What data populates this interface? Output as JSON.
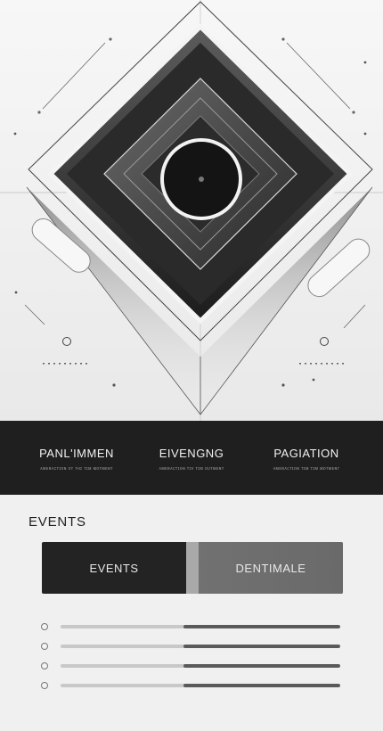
{
  "nav": {
    "items": [
      {
        "label": "PANL'IMMEN",
        "sub": "ᴀᴍᴇʀᴀᴄᴛɪᴏɴ ᴏᴛ ᴛʜɪ ᴛɪᴍ ᴍᴏᴛᴍᴇɴᴛ"
      },
      {
        "label": "EIVENGNG",
        "sub": "ᴀᴍᴇʀᴀᴄᴛɪᴏɴ ᴛɪᴠ ᴛɪᴍ ᴏᴜᴛᴍᴇɴᴛ"
      },
      {
        "label": "PAGIATION",
        "sub": "ᴀᴍᴇʀᴀᴄᴛɪᴏɴ ᴛɪᴍ ᴛɪᴍ ᴍᴏᴛᴍᴇɴᴛ"
      }
    ]
  },
  "section": {
    "title": "EVENTS"
  },
  "tabs": [
    {
      "label": "EVENTS",
      "active": true
    },
    {
      "label": "DENTIMALE",
      "active": false
    }
  ],
  "list": {
    "items": [
      {
        "progress": 0.56
      },
      {
        "progress": 0.56
      },
      {
        "progress": 0.56
      },
      {
        "progress": 0.56
      }
    ]
  },
  "colors": {
    "dark": "#1f1f1f",
    "accent": "#6e6e6e",
    "light": "#f0f0f0"
  }
}
